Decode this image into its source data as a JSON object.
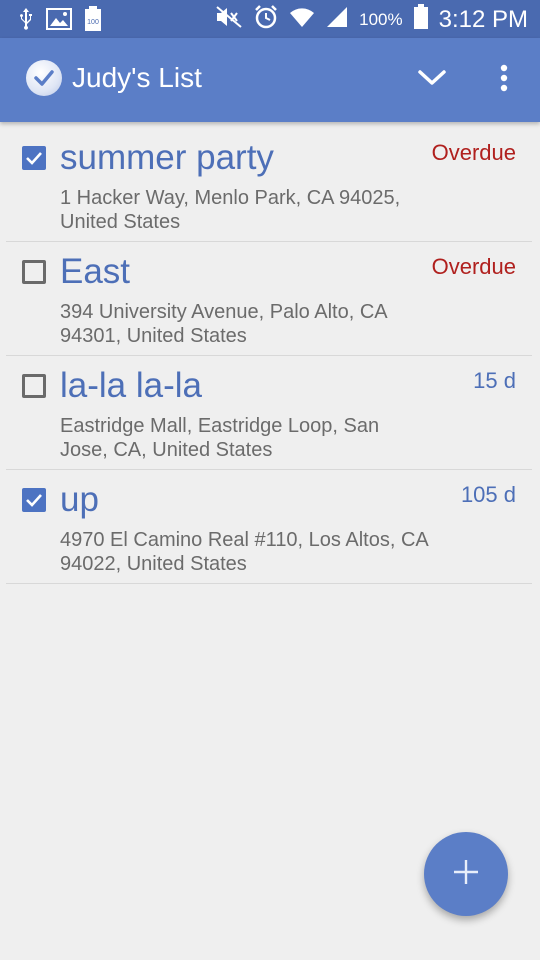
{
  "status_bar": {
    "battery_percent": "100%",
    "time": "3:12 PM",
    "icons": [
      "usb-icon",
      "image-icon",
      "battery-notification-icon",
      "mute-icon",
      "alarm-icon",
      "wifi-icon",
      "signal-icon",
      "battery-icon"
    ],
    "battery_notification_label": "100"
  },
  "toolbar": {
    "title": "Judy's List",
    "collapse_icon": "chevron-down-icon",
    "menu_icon": "more-vert-icon"
  },
  "tasks": [
    {
      "title": "summer party",
      "address": "1 Hacker Way, Menlo Park, CA 94025, United States",
      "due": "Overdue",
      "due_status": "overdue",
      "checked": true
    },
    {
      "title": "East",
      "address": "394 University Avenue, Palo Alto, CA 94301, United States",
      "due": "Overdue",
      "due_status": "overdue",
      "checked": false
    },
    {
      "title": "la-la la-la",
      "address": "Eastridge Mall, Eastridge Loop, San Jose, CA, United States",
      "due": "15 d",
      "due_status": "upcoming",
      "checked": false
    },
    {
      "title": "up",
      "address": "4970 El Camino Real #110, Los Altos, CA 94022, United States",
      "due": "105 d",
      "due_status": "upcoming",
      "checked": true
    }
  ],
  "fab": {
    "icon": "plus-icon"
  },
  "colors": {
    "status_bar": "#4a6ab0",
    "toolbar": "#5b7ec7",
    "accent": "#4d73c2",
    "overdue": "#b0201e",
    "background": "#efefef"
  }
}
